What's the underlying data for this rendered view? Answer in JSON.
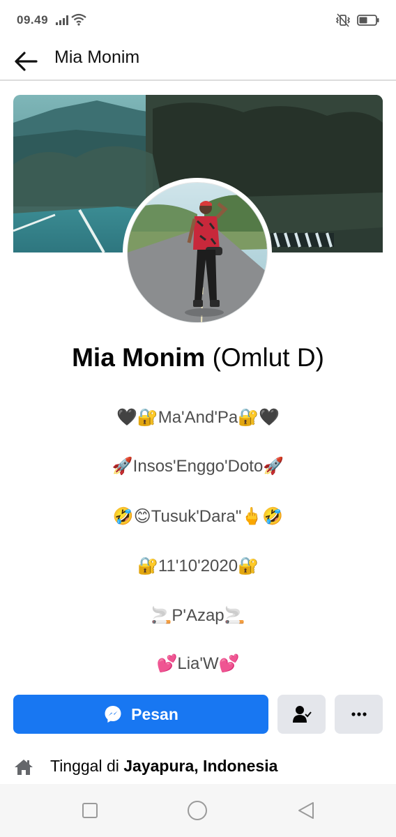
{
  "status_bar": {
    "time": "09.49",
    "icons": [
      "signal-icon",
      "wifi-icon",
      "vibrate-icon",
      "battery-icon"
    ]
  },
  "header": {
    "title": "Mia Monim",
    "back_icon": "arrow-left-icon"
  },
  "profile": {
    "name": "Mia Monim",
    "alternate_name": "(Omlut D)"
  },
  "bio": [
    "🖤🔐Ma'And'Pa🔐🖤",
    "🚀Insos'Enggo'Doto🚀",
    "🤣😊Tusuk'Dara\"🖕🤣",
    "🔐11'10'2020🔐",
    "🚬P'Azap🚬",
    "💕Lia'W💕"
  ],
  "actions": {
    "message_label": "Pesan",
    "message_icon": "messenger-icon",
    "friend_icon": "friends-check-icon",
    "more_icon": "more-icon"
  },
  "details": {
    "lives_prefix": "Tinggal di ",
    "lives_place": "Jayapura, Indonesia",
    "lives_icon": "home-icon"
  },
  "colors": {
    "primary": "#1877f2",
    "secondary_button": "#e4e6eb",
    "text_primary": "#050505",
    "text_secondary": "#4e4e4e"
  }
}
